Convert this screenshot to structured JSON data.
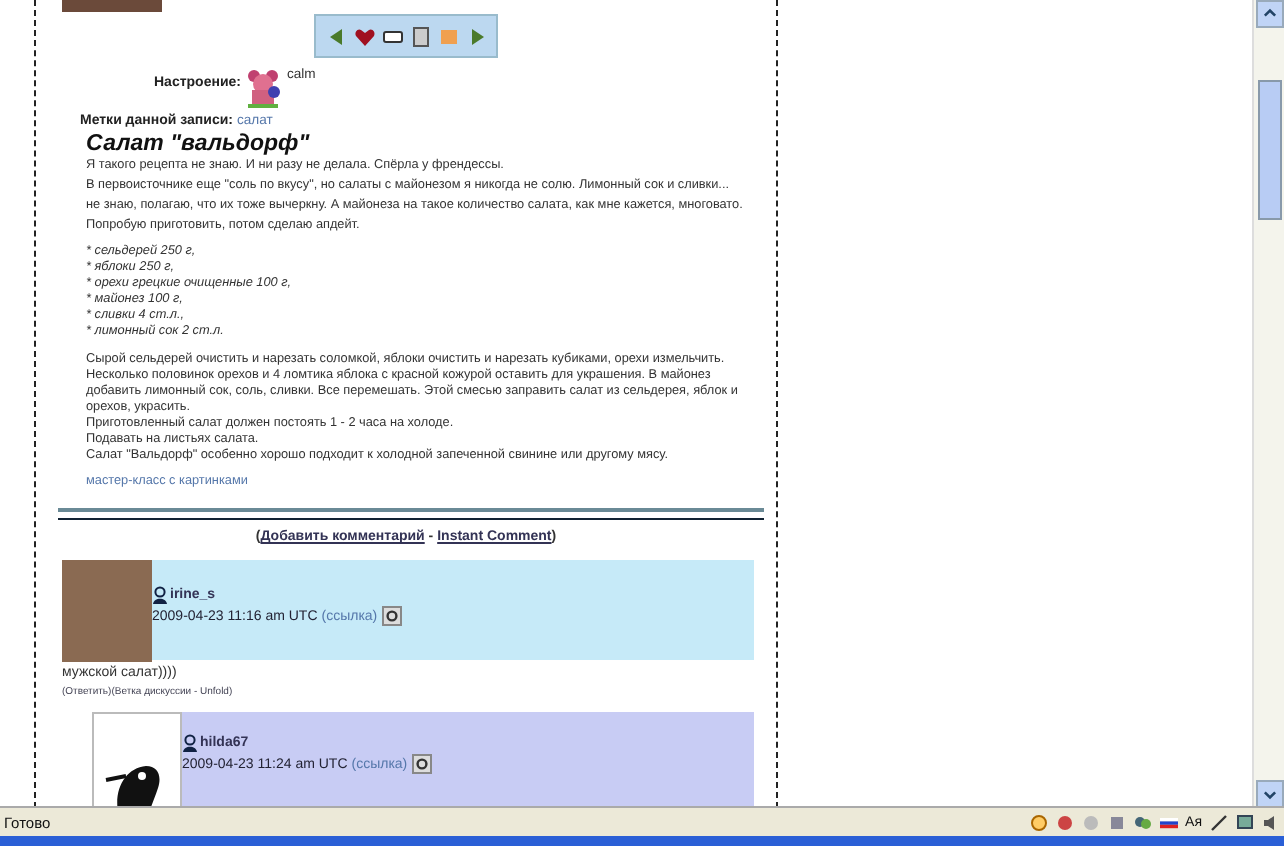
{
  "mood": {
    "label": "Настроение:",
    "value": "calm"
  },
  "tags": {
    "label": "Метки данной записи:",
    "links": [
      "салат"
    ]
  },
  "post": {
    "title": "Салат \"вальдорф\"",
    "intro_lines": [
      "Я такого рецепта не знаю. И ни разу не делала. Спёрла у френдессы.",
      "В первоисточнике еще \"соль по вкусу\", но салаты с майонезом я никогда не солю. Лимонный сок и сливки...",
      "не знаю, полагаю, что их тоже вычеркну. А майонеза на такое количество салата, как мне кажется, многовато.",
      "Попробую приготовить, потом сделаю апдейт."
    ],
    "ingredients": [
      "* сельдерей 250 г,",
      "* яблоки 250 г,",
      "* орехи грецкие очищенные 100 г,",
      "* майонез 100 г,",
      "* сливки 4 ст.л.,",
      "* лимонный сок 2 ст.л."
    ],
    "method_lines": [
      "Сырой сельдерей очистить и нарезать соломкой, яблоки очистить и нарезать кубиками, орехи измельчить.",
      "Несколько половинок орехов и 4 ломтика яблока с красной кожурой оставить для украшения. В майонез",
      "добавить лимонный сок, соль, сливки. Все перемешать. Этой смесью заправить салат из сельдерея, яблок и",
      "орехов, украсить.",
      "Приготовленный салат должен постоять 1 - 2 часа на холоде.",
      "Подавать на листьях салата.",
      "Салат \"Вальдорф\" особенно хорошо подходит к холодной запеченной свинине или другому мясу."
    ],
    "link": "мастер-класс с картинками"
  },
  "comment_bar": {
    "prefix": "(",
    "links": [
      "Добавить комментарий",
      "Instant Comment"
    ],
    "separator": " - ",
    "suffix": ")"
  },
  "comments": [
    {
      "user": "irine_s",
      "time": "2009-04-23 11:16 am UTC",
      "link": "(ссылка)",
      "body": "мужской салат))))",
      "actions": "(Ответить)(Ветка дискуссии - Unfold)",
      "nested": false
    },
    {
      "user": "hilda67",
      "time": "2009-04-23 11:24 am UTC",
      "link": "(ссылка)",
      "nested": true
    }
  ],
  "status_bar": {
    "text": "Готово",
    "language": "Aя"
  }
}
